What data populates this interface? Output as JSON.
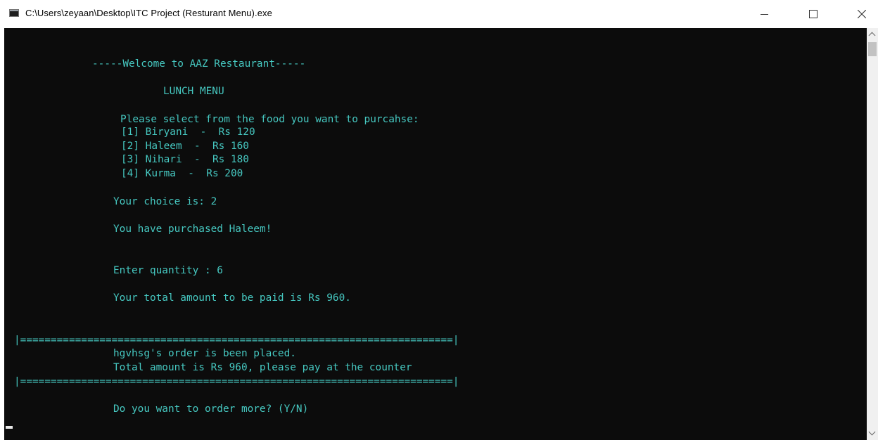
{
  "window": {
    "title": "C:\\Users\\zeyaan\\Desktop\\ITC Project (Resturant Menu).exe"
  },
  "console": {
    "lines": [
      "-----Welcome to AAZ Restaurant-----",
      "LUNCH MENU",
      "Please select from the food you want to purcahse:",
      "[1] Biryani  -  Rs 120",
      "[2] Haleem  -  Rs 160",
      "[3] Nihari  -  Rs 180",
      "[4] Kurma  -  Rs 200",
      "Your choice is: 2",
      "You have purchased Haleem!",
      "Enter quantity : 6",
      "Your total amount to be paid is Rs 960.",
      "|=======================================================================|",
      "hgvhsg's order is been placed.",
      "Total amount is Rs 960, please pay at the counter",
      "|=======================================================================|",
      "Do you want to order more? (Y/N)"
    ]
  },
  "colors": {
    "console_background": "#0c0c0c",
    "console_text": "#46c8c1",
    "titlebar": "#ffffff"
  }
}
